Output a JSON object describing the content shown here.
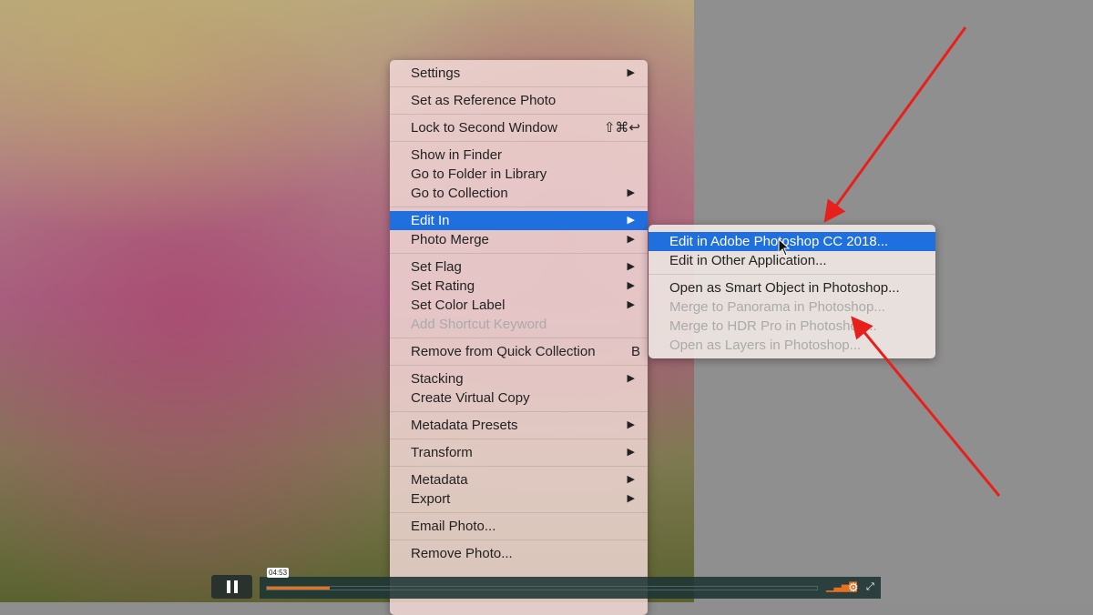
{
  "main_menu": {
    "groups": [
      [
        {
          "label": "Settings",
          "submenu": true
        }
      ],
      [
        {
          "label": "Set as Reference Photo"
        }
      ],
      [
        {
          "label": "Lock to Second Window",
          "shortcut": "⇧⌘↩"
        }
      ],
      [
        {
          "label": "Show in Finder"
        },
        {
          "label": "Go to Folder in Library"
        },
        {
          "label": "Go to Collection",
          "submenu": true
        }
      ],
      [
        {
          "label": "Edit In",
          "submenu": true,
          "highlighted": true
        },
        {
          "label": "Photo Merge",
          "submenu": true
        }
      ],
      [
        {
          "label": "Set Flag",
          "submenu": true
        },
        {
          "label": "Set Rating",
          "submenu": true
        },
        {
          "label": "Set Color Label",
          "submenu": true
        },
        {
          "label": "Add Shortcut Keyword",
          "disabled": true
        }
      ],
      [
        {
          "label": "Remove from Quick Collection",
          "shortcut": "B"
        }
      ],
      [
        {
          "label": "Stacking",
          "submenu": true
        },
        {
          "label": "Create Virtual Copy"
        }
      ],
      [
        {
          "label": "Metadata Presets",
          "submenu": true
        }
      ],
      [
        {
          "label": "Transform",
          "submenu": true
        }
      ],
      [
        {
          "label": "Metadata",
          "submenu": true
        },
        {
          "label": "Export",
          "submenu": true
        }
      ],
      [
        {
          "label": "Email Photo..."
        }
      ],
      [
        {
          "label": "Remove Photo..."
        }
      ]
    ]
  },
  "sub_menu": {
    "groups": [
      [
        {
          "label": "Edit in Adobe Photoshop CC 2018...",
          "highlighted": true
        },
        {
          "label": "Edit in Other Application..."
        }
      ],
      [
        {
          "label": "Open as Smart Object in Photoshop..."
        },
        {
          "label": "Merge to Panorama in Photoshop...",
          "disabled": true
        },
        {
          "label": "Merge to HDR Pro in Photoshop...",
          "disabled": true
        },
        {
          "label": "Open as Layers in Photoshop...",
          "disabled": true
        }
      ]
    ]
  },
  "player": {
    "time": "04:53",
    "progress": 0.115,
    "state": "playing",
    "accent": "#e8701f"
  },
  "annotation_color": "#e8201c"
}
